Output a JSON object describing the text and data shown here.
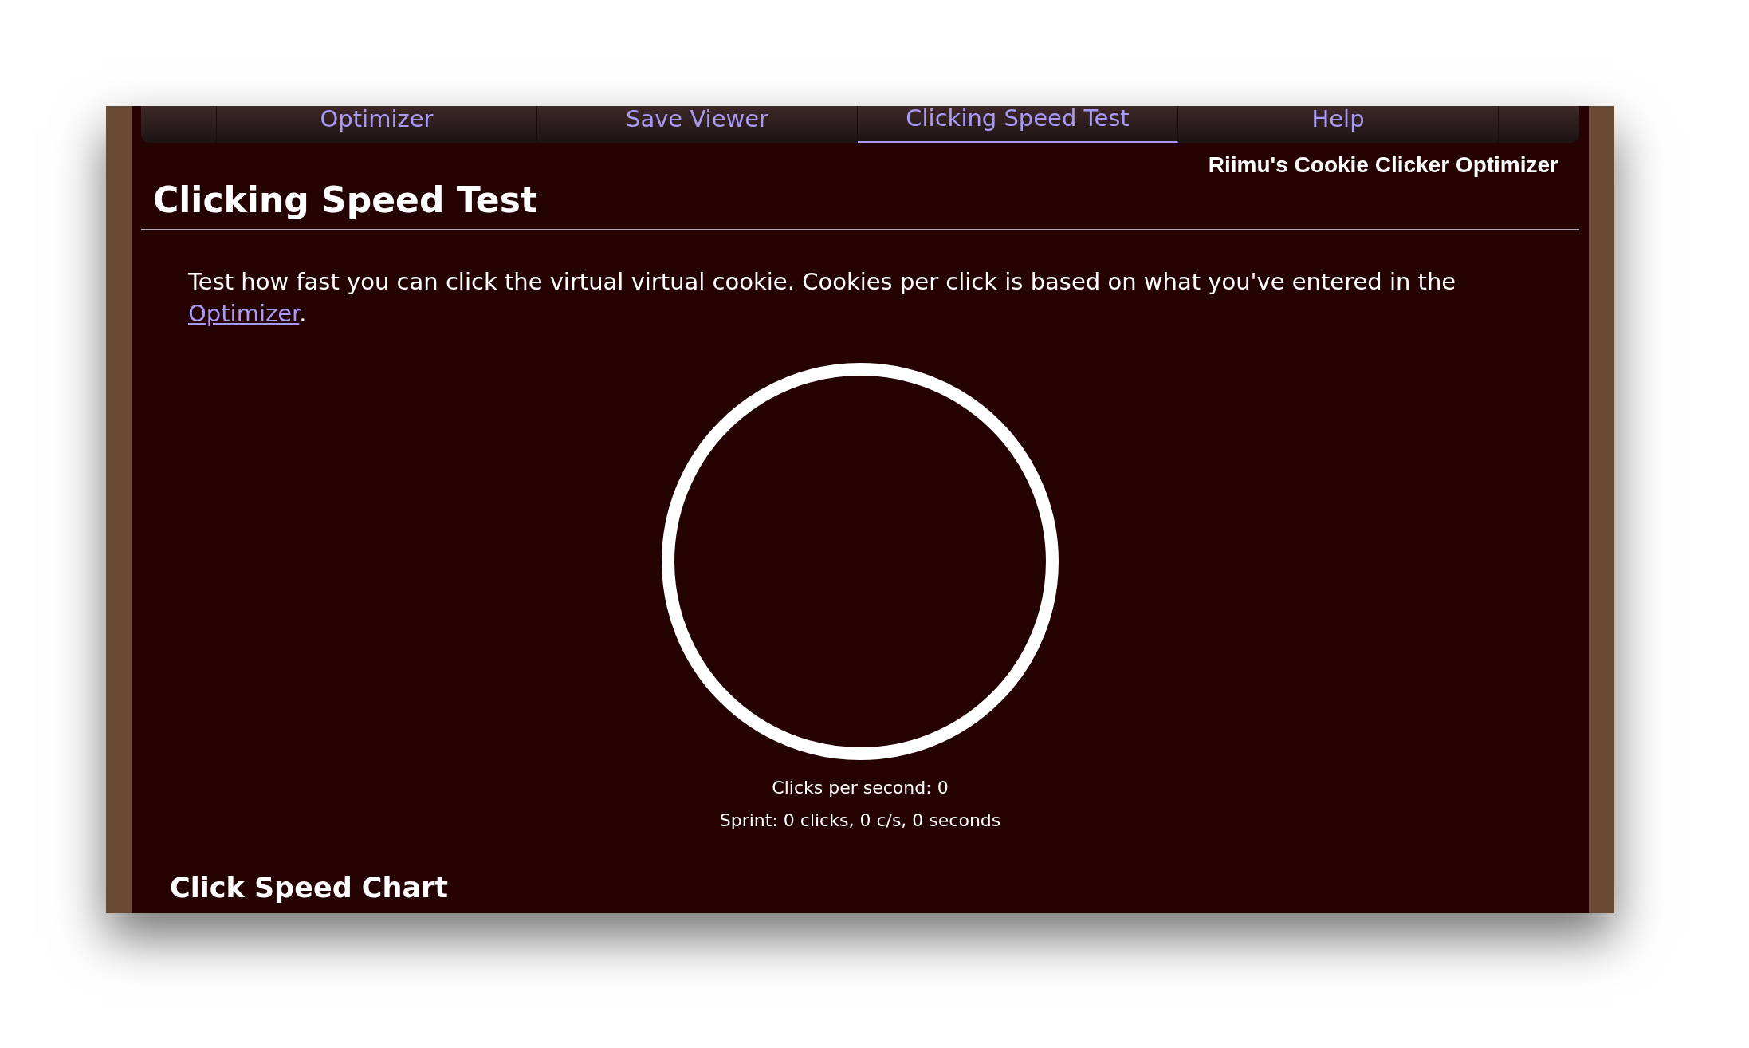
{
  "tabs": [
    {
      "label": "Optimizer",
      "selected": false
    },
    {
      "label": "Save Viewer",
      "selected": false
    },
    {
      "label": "Clicking Speed Test",
      "selected": true
    },
    {
      "label": "Help",
      "selected": false
    }
  ],
  "site_title": "Riimu's Cookie Clicker Optimizer",
  "page_heading": "Clicking Speed Test",
  "intro": {
    "text": "Test how fast you can click the virtual virtual cookie. Cookies per click is based on what you've entered in the ",
    "link": "Optimizer",
    "after": "."
  },
  "stats": [
    "Clicks per second: 0",
    "Sprint: 0 clicks, 0 c/s, 0 seconds"
  ],
  "section_heading": "Click Speed Chart"
}
